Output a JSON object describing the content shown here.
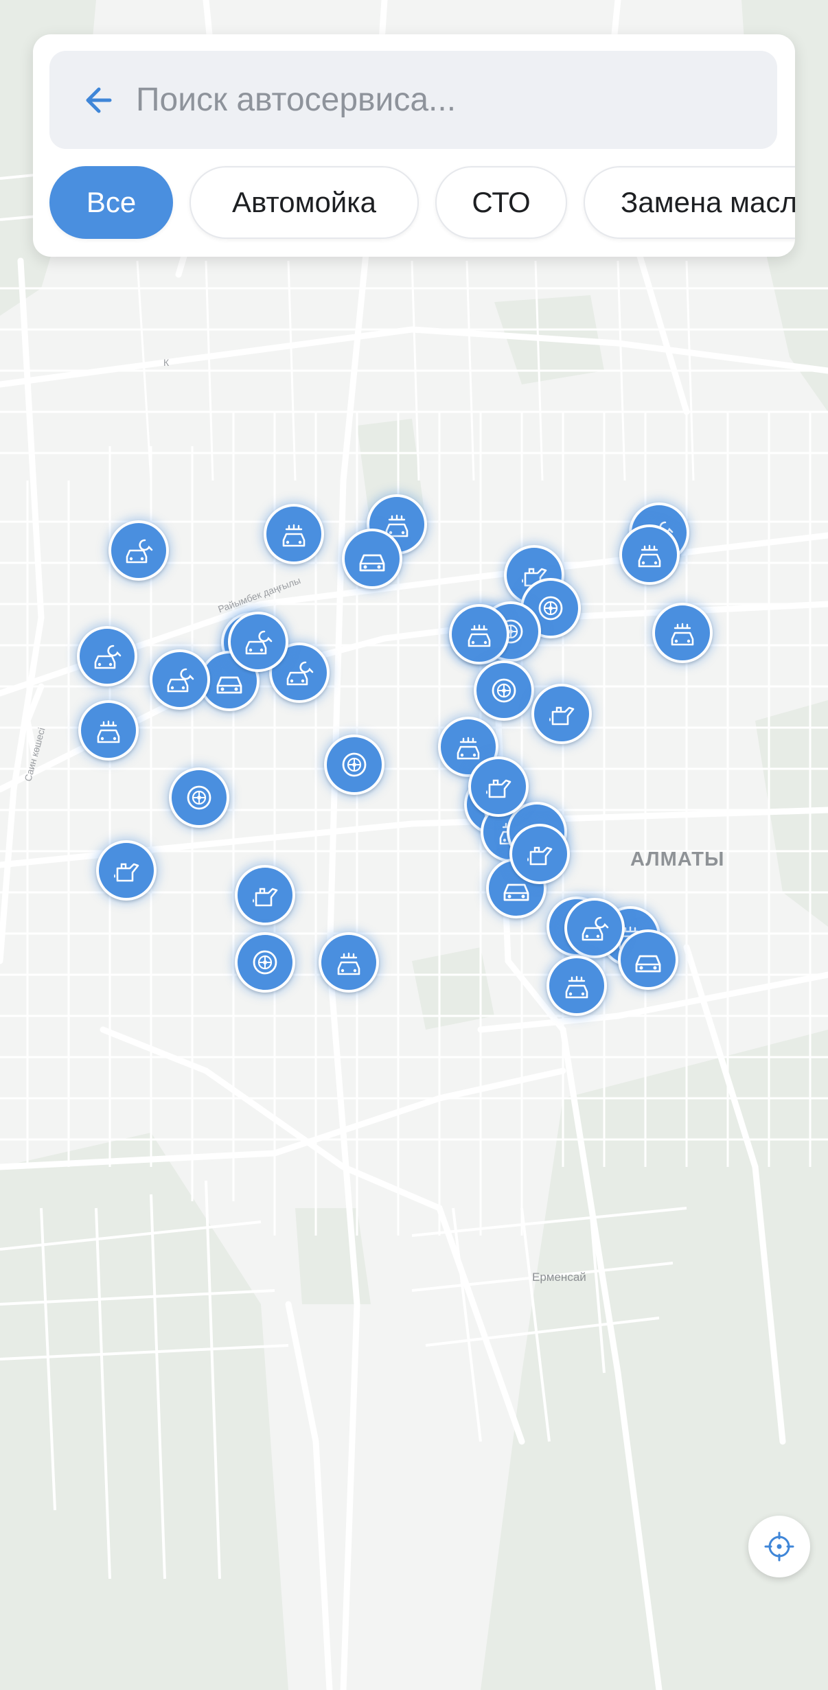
{
  "search": {
    "placeholder": "Поиск автосервиса..."
  },
  "filters": [
    {
      "label": "Все",
      "active": true
    },
    {
      "label": "Автомойка",
      "active": false
    },
    {
      "label": "СТО",
      "active": false
    },
    {
      "label": "Замена масла",
      "active": false
    }
  ],
  "map": {
    "labels": {
      "city": "АЛМАТЫ",
      "district": "Ерменсай",
      "street_1": "Райымбек даңғылы",
      "street_2": "Саин көшесі",
      "letter": "К"
    }
  },
  "colors": {
    "accent": "#4a8fdf",
    "map_bg": "#f3f4f3",
    "road": "#ffffff",
    "park": "#e6ebe4"
  },
  "markers": [
    {
      "icon": "car-service-icon"
    },
    {
      "icon": "car-wash-icon"
    },
    {
      "icon": "car-wash-icon"
    },
    {
      "icon": "car-icon"
    },
    {
      "icon": "car-service-icon"
    },
    {
      "icon": "car-service-icon"
    },
    {
      "icon": "car-icon"
    },
    {
      "icon": "car-service-icon"
    },
    {
      "icon": "car-service-icon"
    },
    {
      "icon": "car-service-icon"
    },
    {
      "icon": "car-wash-icon"
    },
    {
      "icon": "tire-icon"
    },
    {
      "icon": "tire-icon"
    },
    {
      "icon": "oil-can-icon"
    },
    {
      "icon": "oil-can-icon"
    },
    {
      "icon": "tire-icon"
    },
    {
      "icon": "car-wash-icon"
    },
    {
      "icon": "car-service-icon"
    },
    {
      "icon": "car-wash-icon"
    },
    {
      "icon": "oil-can-icon"
    },
    {
      "icon": "tire-icon"
    },
    {
      "icon": "oil-can-icon"
    },
    {
      "icon": "tire-icon"
    },
    {
      "icon": "car-wash-icon"
    },
    {
      "icon": "tire-icon"
    },
    {
      "icon": "oil-can-icon"
    },
    {
      "icon": "car-wash-icon"
    },
    {
      "icon": "oil-can-icon"
    },
    {
      "icon": "car-wash-icon"
    },
    {
      "icon": "oil-can-icon"
    },
    {
      "icon": "car-icon"
    },
    {
      "icon": "oil-can-icon"
    },
    {
      "icon": "oil-can-icon"
    },
    {
      "icon": "tire-icon"
    },
    {
      "icon": "car-wash-icon"
    },
    {
      "icon": "car-icon"
    },
    {
      "icon": "car-service-icon"
    },
    {
      "icon": "car-wash-icon"
    },
    {
      "icon": "car-wash-icon"
    }
  ],
  "locate_button": {
    "icon": "crosshair-icon"
  }
}
